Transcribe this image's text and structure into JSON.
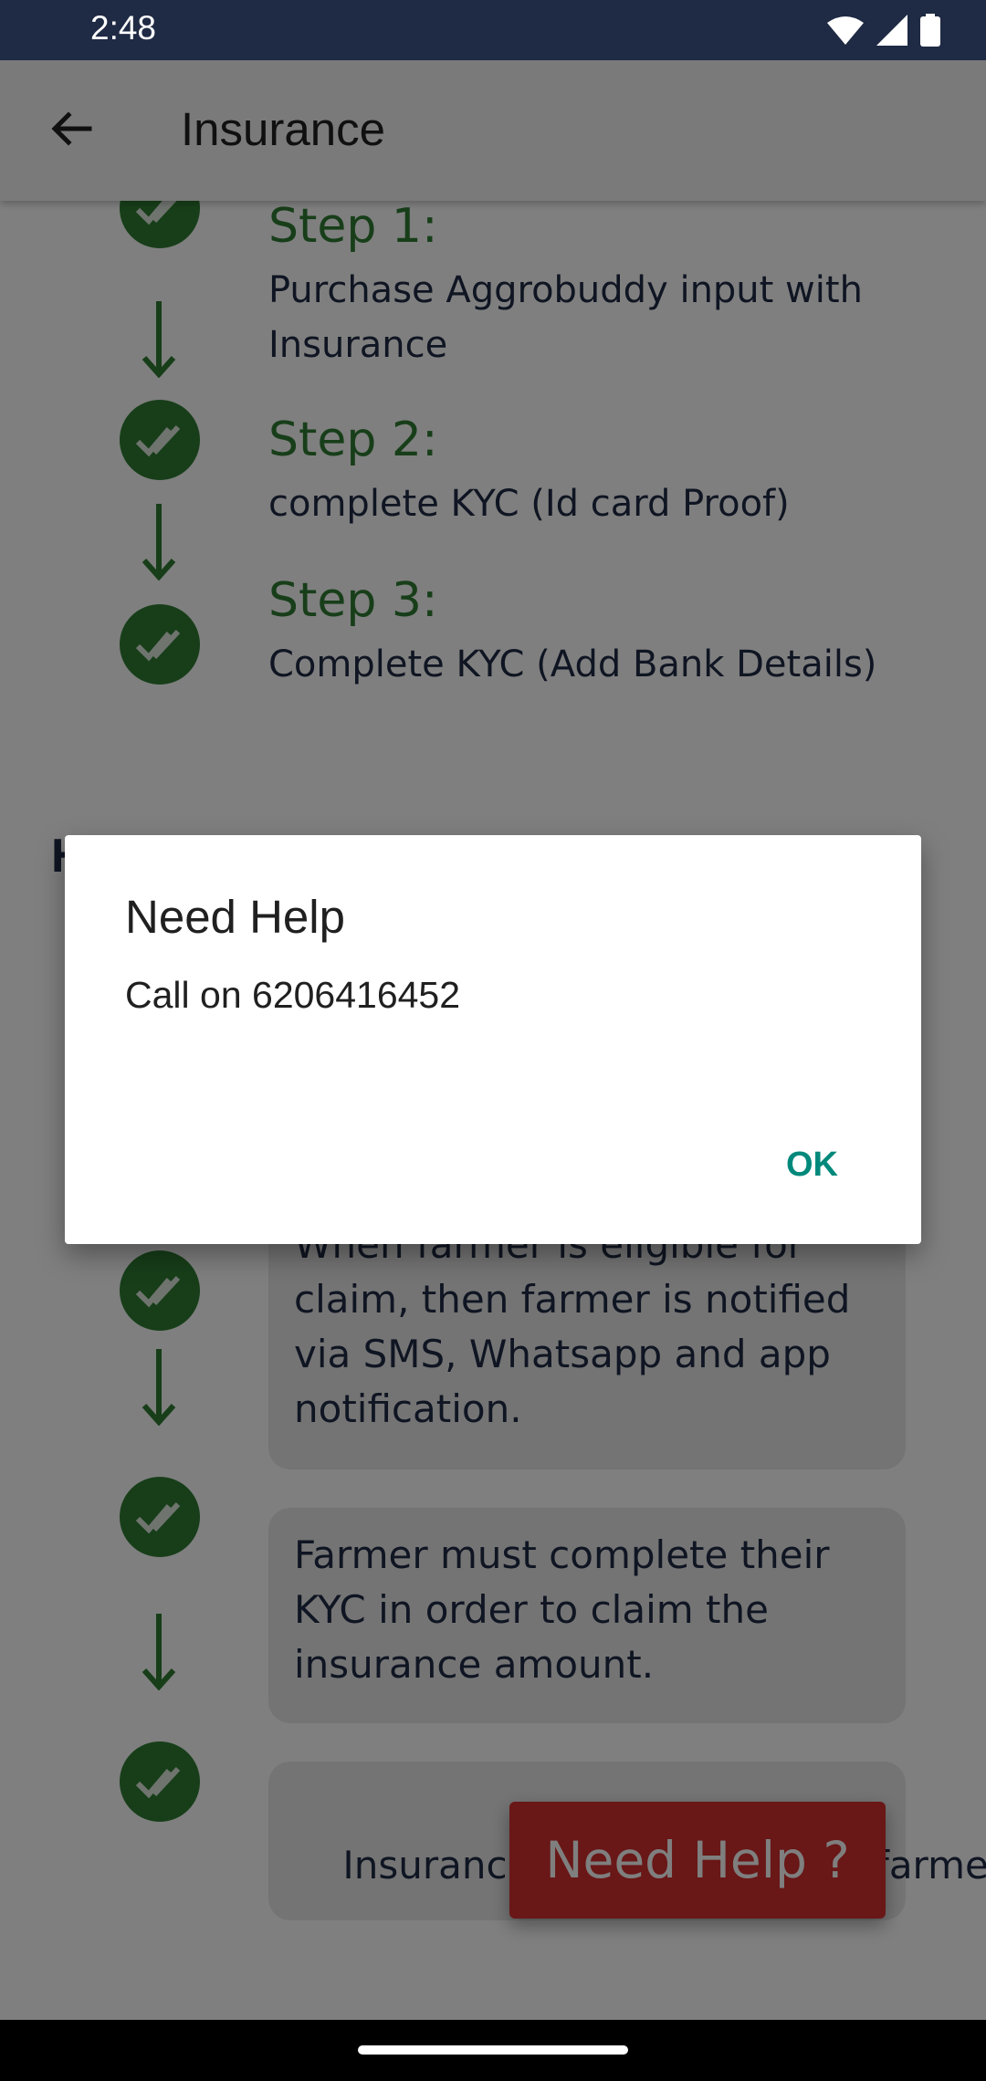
{
  "status_bar": {
    "time": "2:48"
  },
  "app_bar": {
    "title": "Insurance"
  },
  "steps": [
    {
      "title": "Step 1:",
      "description": "Purchase Aggrobuddy input with Insurance"
    },
    {
      "title": "Step 2:",
      "description": "complete KYC (Id card Proof)"
    },
    {
      "title": "Step 3:",
      "description": "Complete KYC (Add Bank Details)"
    }
  ],
  "section_letter": "H",
  "process_cards": [
    "When farmer is eligible for claim, then farmer is notified via SMS, Whatsapp and app notification.",
    "Farmer must complete their KYC in order to claim the insurance amount.",
    "Insurance a          will      to farmer's"
  ],
  "fab_label": "Need Help ?",
  "dialog": {
    "title": "Need Help",
    "message": "Call on 6206416452",
    "ok_label": "OK"
  },
  "colors": {
    "accent_green": "#2e7d32",
    "status_bar": "#1f2a44",
    "fab_red": "#d32f2f",
    "dialog_button": "#00897b"
  }
}
